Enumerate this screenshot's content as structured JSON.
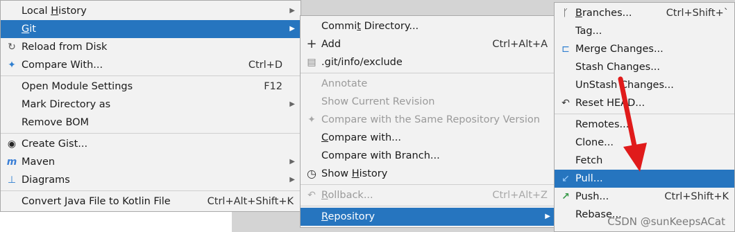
{
  "menu1": {
    "items": [
      {
        "label": "Local ",
        "ul": "H",
        "rest": "istory",
        "arrow": "▶"
      },
      {
        "label": "",
        "ul": "G",
        "rest": "it",
        "arrow": "▶"
      },
      {
        "label": "Reload from Disk",
        "icon": "↻"
      },
      {
        "label": "Compare With...",
        "shortcut": "Ctrl+D",
        "icon": "✦"
      },
      {
        "label": "Open Module Settings",
        "shortcut": "F12"
      },
      {
        "label": "Mark Directory as",
        "arrow": "▶"
      },
      {
        "label": "Remove BOM"
      },
      {
        "label": "Create Gist...",
        "icon": "◉"
      },
      {
        "label": "Maven",
        "arrow": "▶",
        "icon": "m"
      },
      {
        "label": "Diagrams",
        "arrow": "▶",
        "icon": "⊥"
      },
      {
        "label": "Convert Java File to Kotlin File",
        "shortcut": "Ctrl+Alt+Shift+K"
      }
    ]
  },
  "menu2": {
    "items": [
      {
        "label": "Commi",
        "ul": "t",
        "rest": " Directory..."
      },
      {
        "label": "Add",
        "shortcut": "Ctrl+Alt+A",
        "icon": "+"
      },
      {
        "label": ".git/info/exclude",
        "icon": "▤"
      },
      {
        "label": "Annotate"
      },
      {
        "label": "Show Current Revision"
      },
      {
        "label": "Compare with the Same Repository Version",
        "icon": "✦"
      },
      {
        "label": "",
        "ul": "C",
        "rest": "ompare with..."
      },
      {
        "label": "Compare with Branch..."
      },
      {
        "label": "Show ",
        "ul": "H",
        "rest": "istory",
        "icon": "◷"
      },
      {
        "label": "",
        "ul": "R",
        "rest": "ollback...",
        "shortcut": "Ctrl+Alt+Z",
        "icon": "↶"
      },
      {
        "label": "",
        "ul": "R",
        "rest": "epository",
        "arrow": "▶"
      }
    ]
  },
  "menu3": {
    "items": [
      {
        "label": "",
        "ul": "B",
        "rest": "ranches...",
        "shortcut": "Ctrl+Shift+`",
        "icon": "ᚴ"
      },
      {
        "label": "Tag..."
      },
      {
        "label": "Merge Changes...",
        "icon": "⊏"
      },
      {
        "label": "Stash Changes..."
      },
      {
        "label": "UnStash Changes..."
      },
      {
        "label": "Reset HEAD...",
        "icon": "↶"
      },
      {
        "label": "Remotes..."
      },
      {
        "label": "Clone..."
      },
      {
        "label": "Fetch"
      },
      {
        "label": "Pull...",
        "icon": "↙"
      },
      {
        "label": "Push...",
        "shortcut": "Ctrl+Shift+K",
        "icon": "↗"
      },
      {
        "label": "Rebase..."
      }
    ]
  },
  "watermark": "CSDN @sunKeepsACat"
}
